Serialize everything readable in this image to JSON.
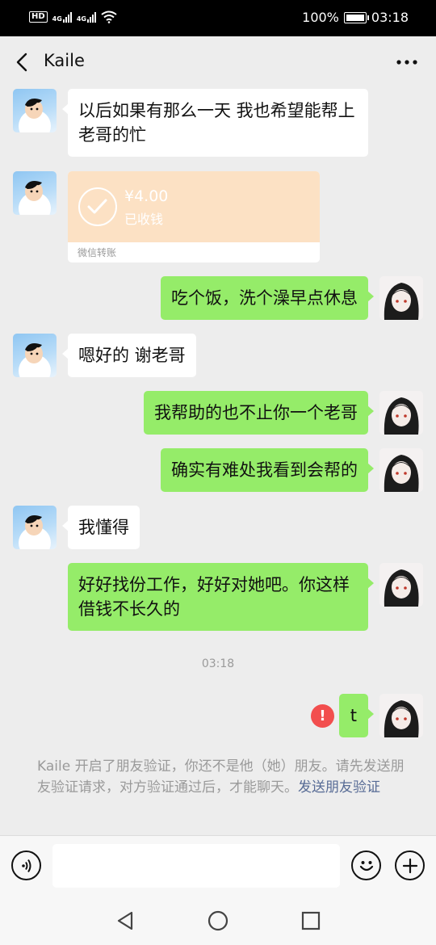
{
  "status_bar": {
    "hd": "HD",
    "hd_sub": "B",
    "net1": "4G",
    "net2": "4G",
    "battery": "100%",
    "time": "03:18"
  },
  "header": {
    "title": "Kaile"
  },
  "messages": [
    {
      "side": "left",
      "text": "以后如果有那么一天 我也希望能帮上老哥的忙"
    },
    {
      "side": "left",
      "type": "transfer",
      "amount": "¥4.00",
      "status": "已收钱",
      "footer": "微信转账"
    },
    {
      "side": "right",
      "text": "吃个饭，洗个澡早点休息"
    },
    {
      "side": "left",
      "text": "嗯好的 谢老哥"
    },
    {
      "side": "right",
      "text": "我帮助的也不止你一个老哥"
    },
    {
      "side": "right",
      "text": "确实有难处我看到会帮的"
    },
    {
      "side": "left",
      "text": "我懂得"
    },
    {
      "side": "right",
      "text": "好好找份工作，好好对她吧。你这样借钱不长久的"
    },
    {
      "side": "right",
      "text": "t",
      "failed": true
    }
  ],
  "timestamp": "03:18",
  "error_mark": "!",
  "notice": {
    "text": "Kaile 开启了朋友验证，你还不是他（她）朋友。请先发送朋友验证请求，对方验证通过后，才能聊天。",
    "link": "发送朋友验证"
  },
  "input": {
    "value": "",
    "placeholder": ""
  },
  "colors": {
    "bubble_right": "#95ec69",
    "bubble_left": "#ffffff",
    "transfer_bg": "#fce1c4",
    "error": "#f24e4e",
    "link": "#576b95"
  },
  "icons": [
    "back-arrow-icon",
    "more-icon",
    "voice-icon",
    "emoji-icon",
    "plus-icon",
    "nav-back-icon",
    "nav-home-icon",
    "nav-recent-icon"
  ]
}
